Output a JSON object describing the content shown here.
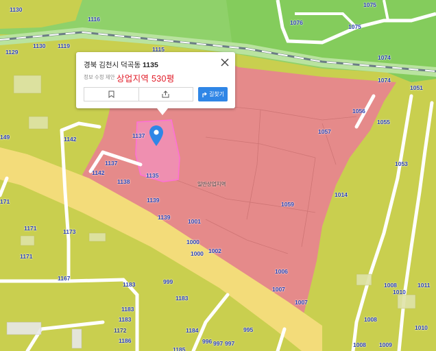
{
  "popup": {
    "address_prefix": "경북 김천시 덕곡동",
    "lot_number": "1135",
    "info_edit": "정보 수정 제안",
    "zone_text": "상업지역 530평",
    "route_label": "길찾기"
  },
  "map": {
    "lots": [
      "1130",
      "1116",
      "1129",
      "1130",
      "1119",
      "1115",
      "1075",
      "1076",
      "1075",
      "1074",
      "1074",
      "1051",
      "1056",
      "1055",
      "1057",
      "1053",
      "1014",
      "1142",
      "1137",
      "1137",
      "1142",
      "1138",
      "1135",
      "1139",
      "1139",
      "1001",
      "1000",
      "1000",
      "1002",
      "1059",
      "1006",
      "1007",
      "1007",
      "1171",
      "1173",
      "1171",
      "1167",
      "1183",
      "999",
      "1183",
      "1183",
      "1183",
      "1172",
      "1186",
      "1184",
      "996",
      "997",
      "997",
      "995",
      "1185",
      "1008",
      "1008",
      "1010",
      "1011",
      "1010",
      "1009",
      "1008",
      "149",
      "171"
    ],
    "place_labels": [
      "일반상업지역"
    ],
    "colors": {
      "commercial": "#e58a8a",
      "residential": "#c9cf4f",
      "green": "#7fcf5a",
      "road": "#f3dc7a",
      "highlight": "#ff6fd8",
      "accent": "#2f86e6",
      "zone_text": "#e11a26"
    }
  }
}
